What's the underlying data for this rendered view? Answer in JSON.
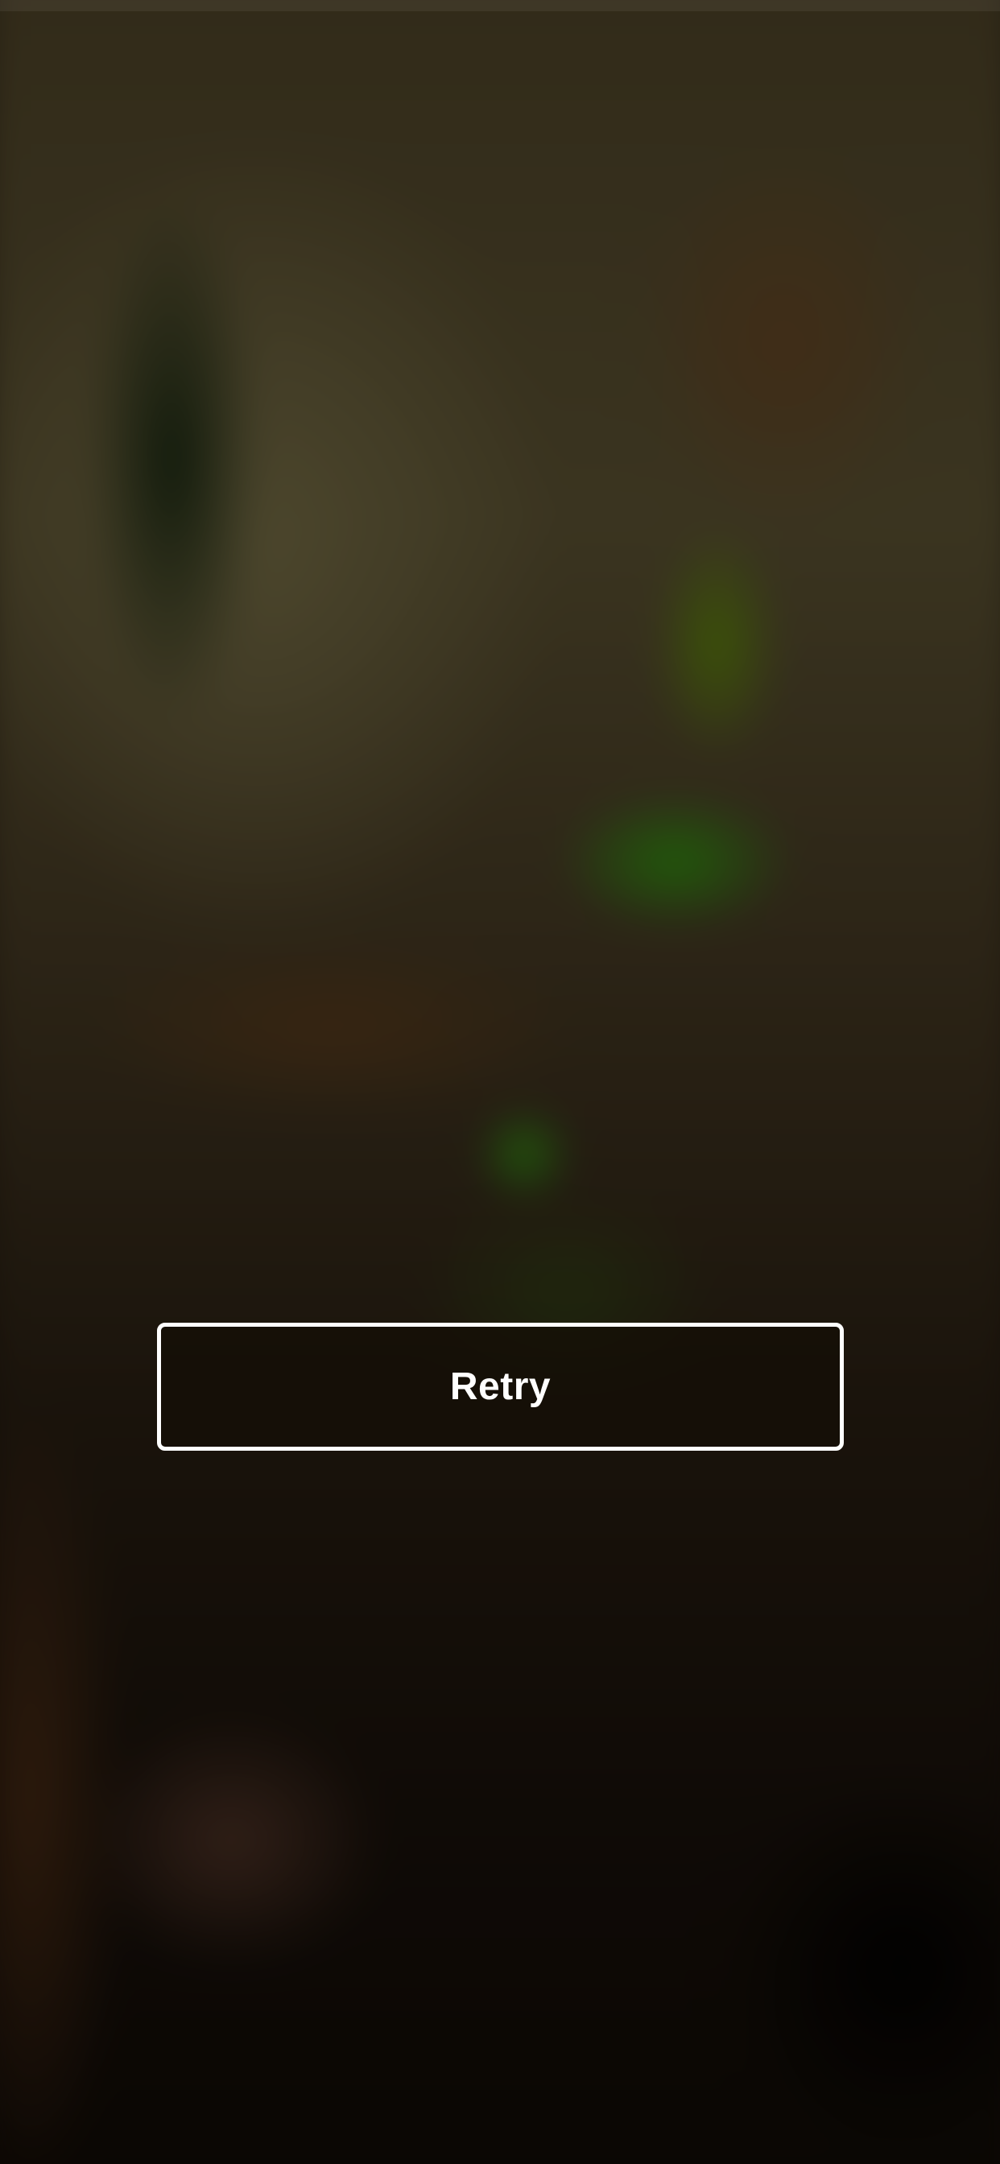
{
  "screen": {
    "background_description_icon": "blurred-artwork-background",
    "overlay_color": "#000000"
  },
  "retry": {
    "label": "Retry",
    "border_color": "#ffffff",
    "text_color": "#ffffff"
  }
}
